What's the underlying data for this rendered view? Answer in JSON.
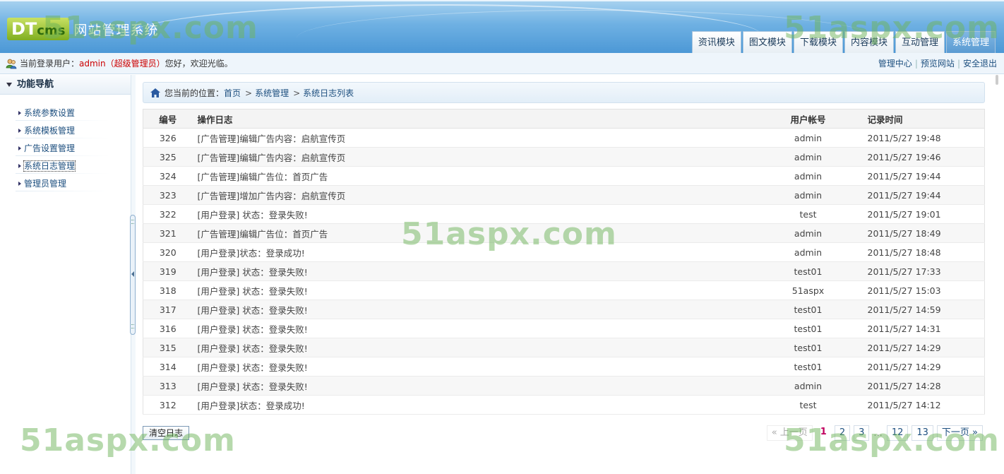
{
  "header": {
    "logo_main": "DT",
    "logo_sub": "cms",
    "system_title": "网站管理系统",
    "tabs": [
      {
        "label": "资讯模块"
      },
      {
        "label": "图文模块"
      },
      {
        "label": "下载模块"
      },
      {
        "label": "内容模块"
      },
      {
        "label": "互动管理"
      },
      {
        "label": "系统管理"
      }
    ]
  },
  "userbar": {
    "prefix": "当前登录用户：",
    "username": "admin（超级管理员）",
    "greeting": "您好，欢迎光临。",
    "links": [
      "管理中心",
      "预览网站",
      "安全退出"
    ]
  },
  "sidebar": {
    "heading": "功能导航",
    "items": [
      {
        "label": "系统参数设置"
      },
      {
        "label": "系统模板管理"
      },
      {
        "label": "广告设置管理"
      },
      {
        "label": "系统日志管理"
      },
      {
        "label": "管理员管理"
      }
    ]
  },
  "breadcrumb": {
    "prefix": "您当前的位置：",
    "items": [
      "首页",
      "系统管理",
      "系统日志列表"
    ]
  },
  "table": {
    "headers": {
      "id": "编号",
      "action": "操作日志",
      "user": "用户帐号",
      "time": "记录时间"
    },
    "rows": [
      {
        "id": "326",
        "action": "[广告管理]编辑广告内容：启航宣传页",
        "user": "admin",
        "time": "2011/5/27 19:48"
      },
      {
        "id": "325",
        "action": "[广告管理]编辑广告内容：启航宣传页",
        "user": "admin",
        "time": "2011/5/27 19:46"
      },
      {
        "id": "324",
        "action": "[广告管理]编辑广告位：首页广告",
        "user": "admin",
        "time": "2011/5/27 19:44"
      },
      {
        "id": "323",
        "action": "[广告管理]增加广告内容：启航宣传页",
        "user": "admin",
        "time": "2011/5/27 19:44"
      },
      {
        "id": "322",
        "action": "[用户登录] 状态：登录失败!",
        "user": "test",
        "time": "2011/5/27 19:01"
      },
      {
        "id": "321",
        "action": "[广告管理]编辑广告位：首页广告",
        "user": "admin",
        "time": "2011/5/27 18:49"
      },
      {
        "id": "320",
        "action": "[用户登录]状态：登录成功!",
        "user": "admin",
        "time": "2011/5/27 18:48"
      },
      {
        "id": "319",
        "action": "[用户登录] 状态：登录失败!",
        "user": "test01",
        "time": "2011/5/27 17:33"
      },
      {
        "id": "318",
        "action": "[用户登录] 状态：登录失败!",
        "user": "51aspx",
        "time": "2011/5/27 15:03"
      },
      {
        "id": "317",
        "action": "[用户登录] 状态：登录失败!",
        "user": "test01",
        "time": "2011/5/27 14:59"
      },
      {
        "id": "316",
        "action": "[用户登录] 状态：登录失败!",
        "user": "test01",
        "time": "2011/5/27 14:31"
      },
      {
        "id": "315",
        "action": "[用户登录] 状态：登录失败!",
        "user": "test01",
        "time": "2011/5/27 14:29"
      },
      {
        "id": "314",
        "action": "[用户登录] 状态：登录失败!",
        "user": "test01",
        "time": "2011/5/27 14:29"
      },
      {
        "id": "313",
        "action": "[用户登录] 状态：登录失败!",
        "user": "admin",
        "time": "2011/5/27 14:28"
      },
      {
        "id": "312",
        "action": "[用户登录]状态：登录成功!",
        "user": "test",
        "time": "2011/5/27 14:12"
      }
    ]
  },
  "actions": {
    "clear_label": "清空日志"
  },
  "pager": {
    "prev": "« 上一页",
    "current": "1",
    "pages": [
      "2",
      "3"
    ],
    "ellipsis": "...",
    "tail_pages": [
      "12",
      "13"
    ],
    "next": "下一页 »"
  },
  "watermark": "51aspx.com"
}
